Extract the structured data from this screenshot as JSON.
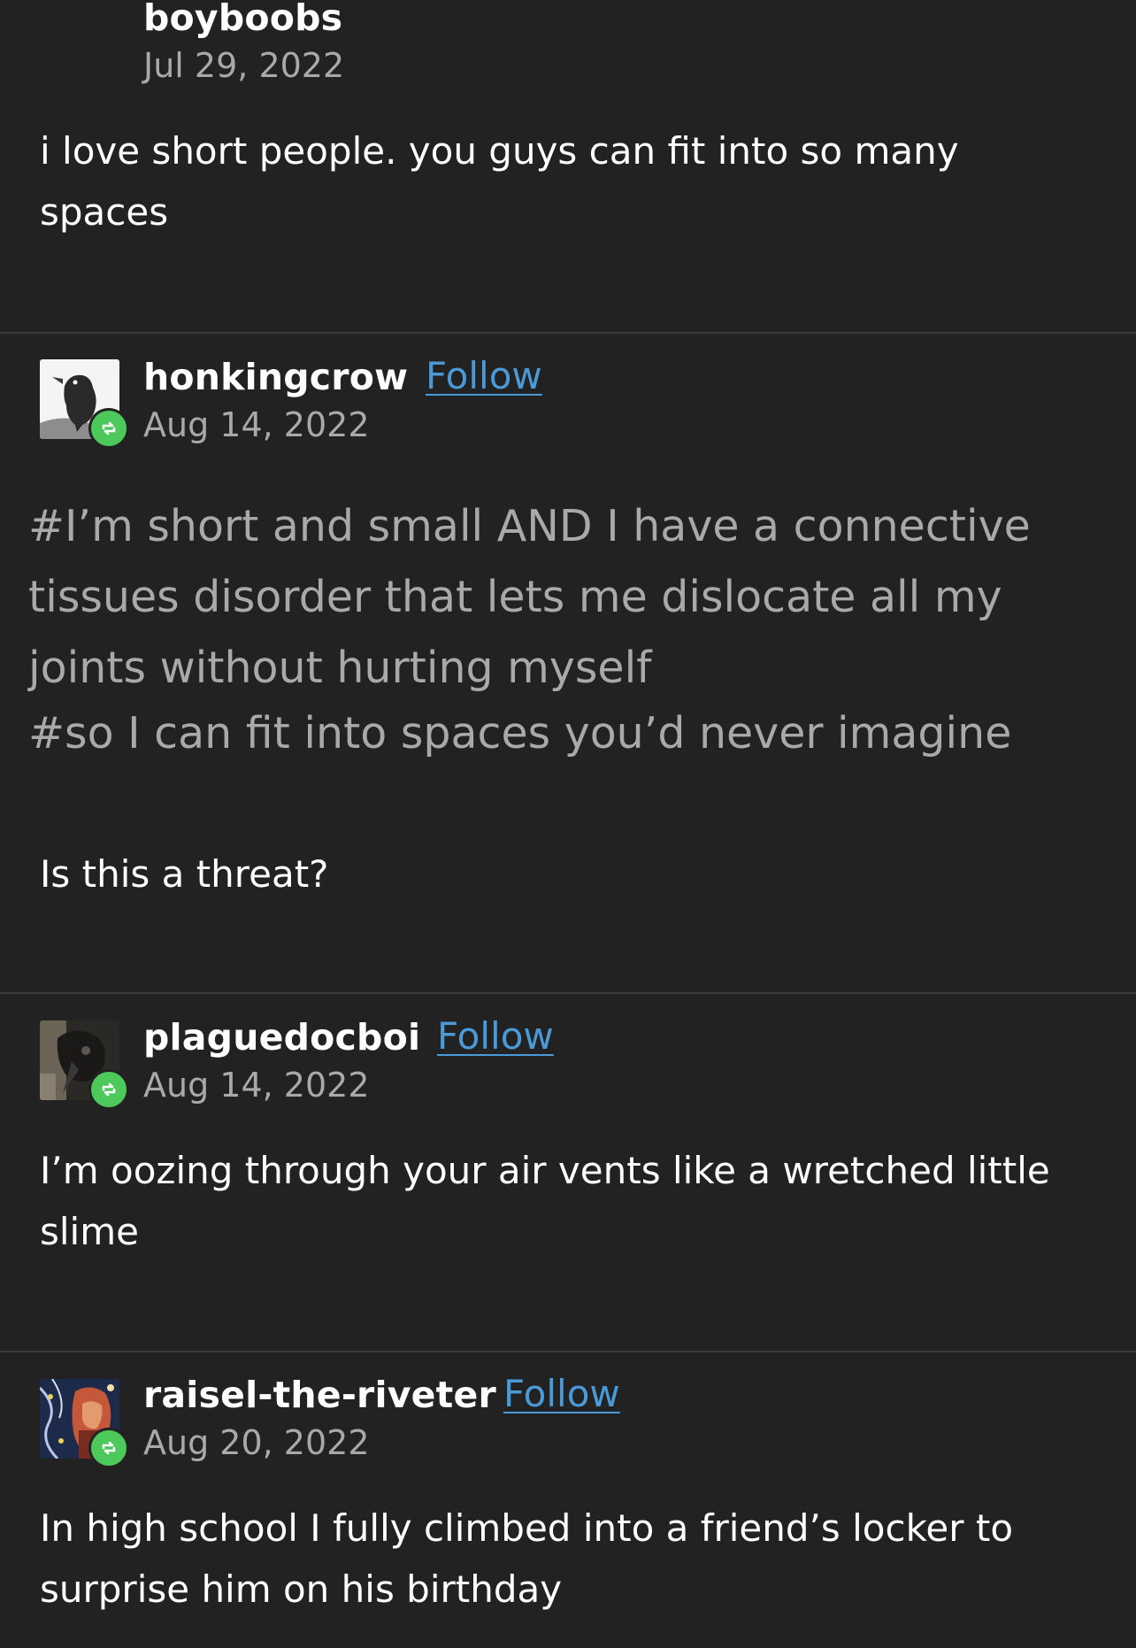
{
  "posts": [
    {
      "username": "boyboobs",
      "date": "Jul 29, 2022",
      "body": "i love short people.  you guys can fit into so many spaces"
    },
    {
      "username": "honkingcrow",
      "follow_label": "Follow",
      "date": "Aug 14, 2022",
      "tags": [
        "#I’m short and small AND I have a connective",
        "tissues disorder that lets me dislocate all my",
        "joints without hurting myself",
        "#so I can fit into spaces you’d never imagine"
      ],
      "body": "Is this a threat?"
    },
    {
      "username": "plaguedocboi",
      "follow_label": "Follow",
      "date": "Aug 14, 2022",
      "body": "I’m oozing through your air vents like a wretched little slime"
    },
    {
      "username": "raisel-the-riveter",
      "follow_label": "Follow",
      "date": "Aug 20, 2022",
      "body": "In high school I fully climbed into a friend’s locker to surprise him on his birthday"
    }
  ],
  "colors": {
    "background": "#222222",
    "link": "#4b9ad8",
    "reblog_badge": "#4cc95a",
    "secondary_text": "#a9a9a9"
  },
  "icons": [
    "crow-avatar",
    "plague-doctor-avatar",
    "riveter-avatar",
    "reblog-icon"
  ]
}
